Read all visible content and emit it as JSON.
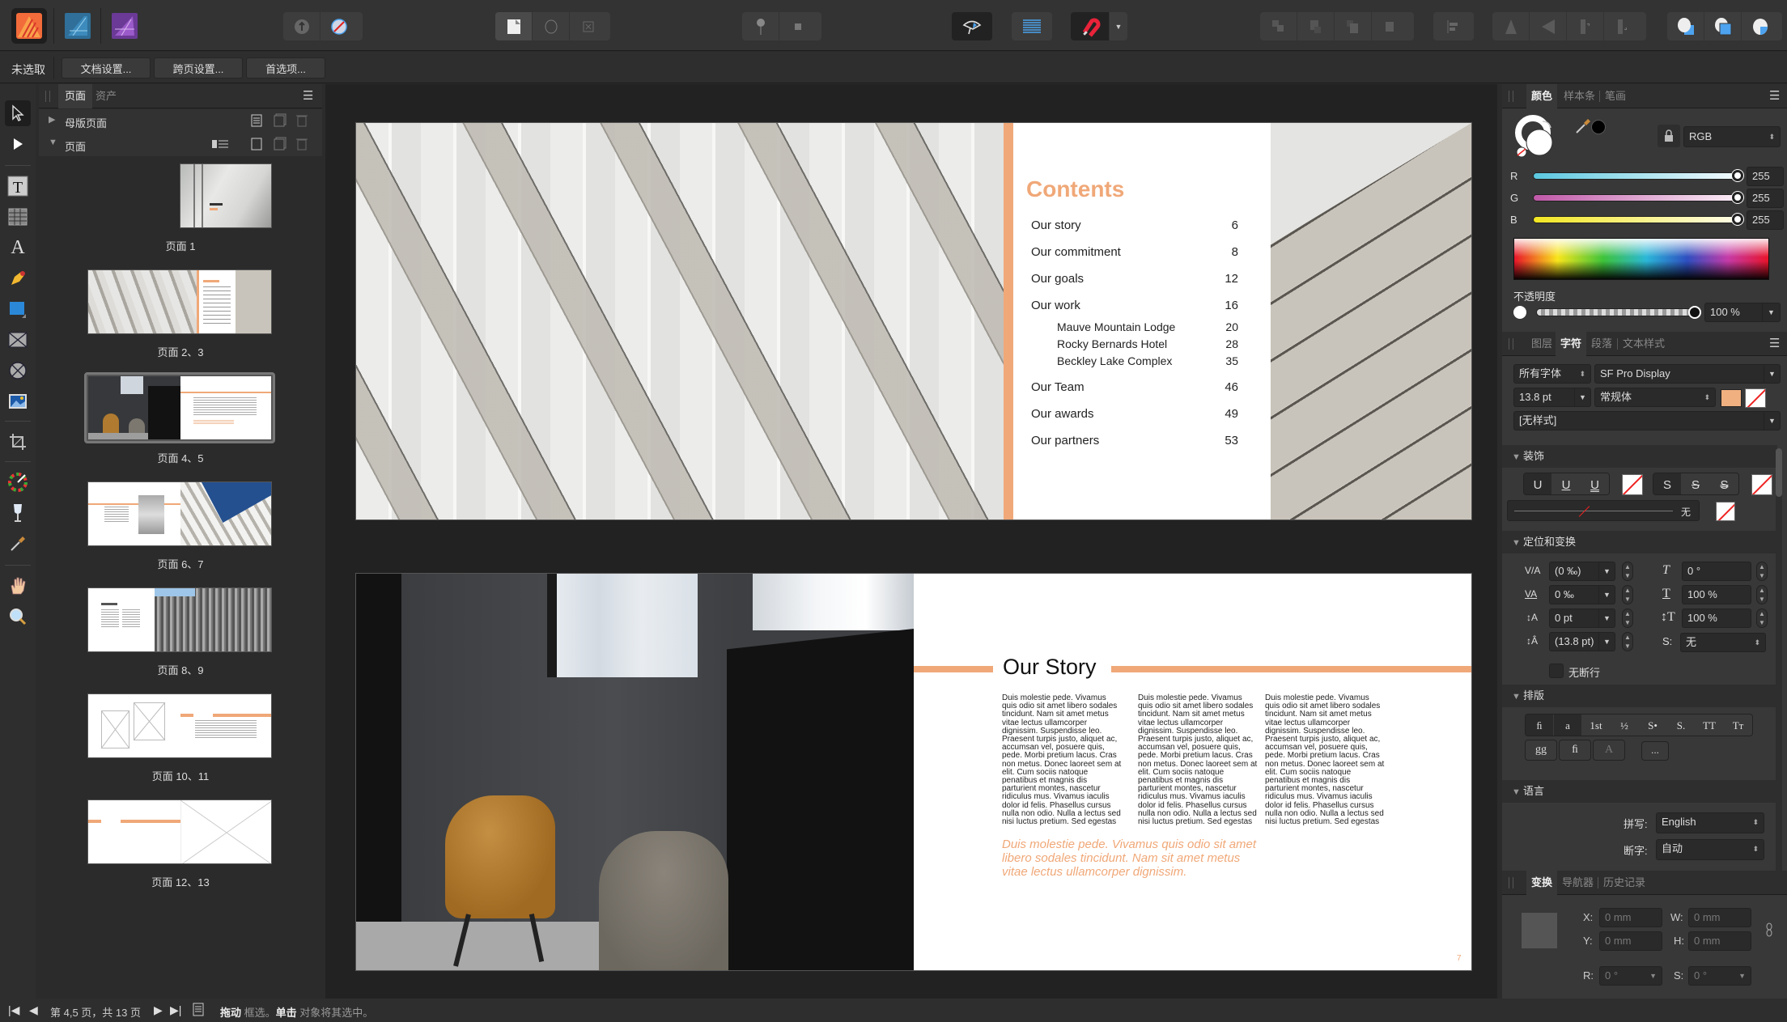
{
  "app": {
    "personas": [
      {
        "name": "publisher-persona",
        "color": "#f47b4a"
      },
      {
        "name": "designer-persona",
        "color": "#3a87b8"
      },
      {
        "name": "photo-persona",
        "color": "#8a4db3"
      }
    ]
  },
  "context_bar": {
    "selection_label": "未选取",
    "buttons": [
      "文档设置...",
      "跨页设置...",
      "首选项..."
    ]
  },
  "pages_panel": {
    "tabs": [
      "页面",
      "资产"
    ],
    "active_tab": "页面",
    "master_pages_label": "母版页面",
    "pages_label": "页面",
    "thumbnails": [
      {
        "label": "页面 1",
        "selected": false
      },
      {
        "label": "页面 2、3",
        "selected": false
      },
      {
        "label": "页面 4、5",
        "selected": true
      },
      {
        "label": "页面 6、7",
        "selected": false
      },
      {
        "label": "页面 8、9",
        "selected": false
      },
      {
        "label": "页面 10、11",
        "selected": false
      },
      {
        "label": "页面 12、13",
        "selected": false
      }
    ]
  },
  "spread_top": {
    "contents": {
      "title": "Contents",
      "entries": [
        {
          "label": "Our story",
          "page": "6",
          "level": 0
        },
        {
          "label": "Our commitment",
          "page": "8",
          "level": 0
        },
        {
          "label": "Our goals",
          "page": "12",
          "level": 0
        },
        {
          "label": "Our work",
          "page": "16",
          "level": 0
        },
        {
          "label": "Mauve Mountain Lodge",
          "page": "20",
          "level": 1
        },
        {
          "label": "Rocky Bernards Hotel",
          "page": "28",
          "level": 1
        },
        {
          "label": "Beckley Lake Complex",
          "page": "35",
          "level": 1
        },
        {
          "label": "Our Team",
          "page": "46",
          "level": 0
        },
        {
          "label": "Our awards",
          "page": "49",
          "level": 0
        },
        {
          "label": "Our partners",
          "page": "53",
          "level": 0
        }
      ]
    }
  },
  "spread_bottom": {
    "heading": "Our Story",
    "body_columns": [
      "Duis molestie pede. Vivamus quis odio sit amet libero sodales tincidunt. Nam sit amet metus vitae lectus ullamcorper dignissim. Suspendisse leo. Praesent turpis justo, aliquet ac, accumsan vel, posuere quis, pede. Morbi pretium lacus. Cras non metus. Donec laoreet sem at elit. Cum sociis natoque penatibus et magnis dis parturient montes, nascetur ridiculus mus. Vivamus iaculis dolor id felis. Phasellus cursus nulla non odio. Nulla a lectus sed nisi luctus pretium. Sed egestas",
      "Duis molestie pede. Vivamus quis odio sit amet libero sodales tincidunt. Nam sit amet metus vitae lectus ullamcorper dignissim. Suspendisse leo. Praesent turpis justo, aliquet ac, accumsan vel, posuere quis, pede. Morbi pretium lacus. Cras non metus. Donec laoreet sem at elit. Cum sociis natoque penatibus et magnis dis parturient montes, nascetur ridiculus mus. Vivamus iaculis dolor id felis. Phasellus cursus nulla non odio. Nulla a lectus sed nisi luctus pretium. Sed egestas",
      "Duis molestie pede. Vivamus quis odio sit amet libero sodales tincidunt. Nam sit amet metus vitae lectus ullamcorper dignissim. Suspendisse leo. Praesent turpis justo, aliquet ac, accumsan vel, posuere quis, pede. Morbi pretium lacus. Cras non metus. Donec laoreet sem at elit. Cum sociis natoque penatibus et magnis dis parturient montes, nascetur ridiculus mus. Vivamus iaculis dolor id felis. Phasellus cursus nulla non odio. Nulla a lectus sed nisi luctus pretium. Sed egestas"
    ],
    "pull_quote": "Duis molestie pede. Vivamus quis odio sit amet libero sodales tincidunt. Nam sit amet metus vitae lectus ullamcorper dignissim.",
    "page_number": "7"
  },
  "colors": {
    "accent": "#f0a878",
    "canvas_bg": "#222222",
    "panel_bg": "#383838"
  },
  "color_panel": {
    "tabs": [
      "颜色",
      "样本条",
      "笔画"
    ],
    "active_tab": "颜色",
    "model": "RGB",
    "channels": [
      {
        "label": "R",
        "value": "255",
        "fraction": 1.0
      },
      {
        "label": "G",
        "value": "255",
        "fraction": 1.0
      },
      {
        "label": "B",
        "value": "255",
        "fraction": 1.0
      }
    ],
    "opacity_label": "不透明度",
    "opacity_value": "100 %",
    "opacity_fraction": 1.0
  },
  "character_panel": {
    "tabs": [
      "图层",
      "字符",
      "段落",
      "文本样式"
    ],
    "active_tab": "字符",
    "font_collection": "所有字体",
    "font_family": "SF Pro Display",
    "font_size": "13.8 pt",
    "font_style": "常规体",
    "text_color": "#f0b080",
    "style": "[无样式]",
    "decorations": {
      "title": "装饰",
      "underline_buttons": [
        "U",
        "U",
        "U"
      ],
      "strike_buttons": [
        "S",
        "S",
        "S"
      ],
      "line_value": "无"
    },
    "positioning": {
      "title": "定位和变换",
      "tracking": "(0 ‰)",
      "kerning": "0 ‰",
      "baseline": "0 pt",
      "leading": "(13.8 pt)",
      "shear": "0 °",
      "horizontal_scale": "100 %",
      "vertical_scale": "100 %",
      "sub_super_label": "S:",
      "sub_super": "无",
      "no_break_label": "无断行",
      "no_break_checked": false
    },
    "typography": {
      "title": "排版",
      "row1": [
        "ﬁ",
        "a",
        "1st",
        "½",
        "S•",
        "S.",
        "TT",
        "Tт"
      ],
      "row2": [
        "gg",
        "ﬁ",
        "A"
      ],
      "more": "..."
    },
    "language": {
      "title": "语言",
      "spelling_label": "拼写:",
      "spelling": "English",
      "hyphenation_label": "断字:",
      "hyphenation": "自动"
    }
  },
  "transform_panel": {
    "tabs": [
      "变换",
      "导航器",
      "历史记录"
    ],
    "active_tab": "变换",
    "x_label": "X:",
    "x": "0 mm",
    "y_label": "Y:",
    "y": "0 mm",
    "w_label": "W:",
    "w": "0 mm",
    "h_label": "H:",
    "h": "0 mm",
    "r_label": "R:",
    "r": "0 °",
    "s_label": "S:",
    "s": "0 °"
  },
  "status_bar": {
    "page_info": "第 4,5 页，共 13 页",
    "hint_bold1": "拖动",
    "hint_text1": "框选。",
    "hint_bold2": "单击",
    "hint_text2": "对象将其选中。"
  }
}
